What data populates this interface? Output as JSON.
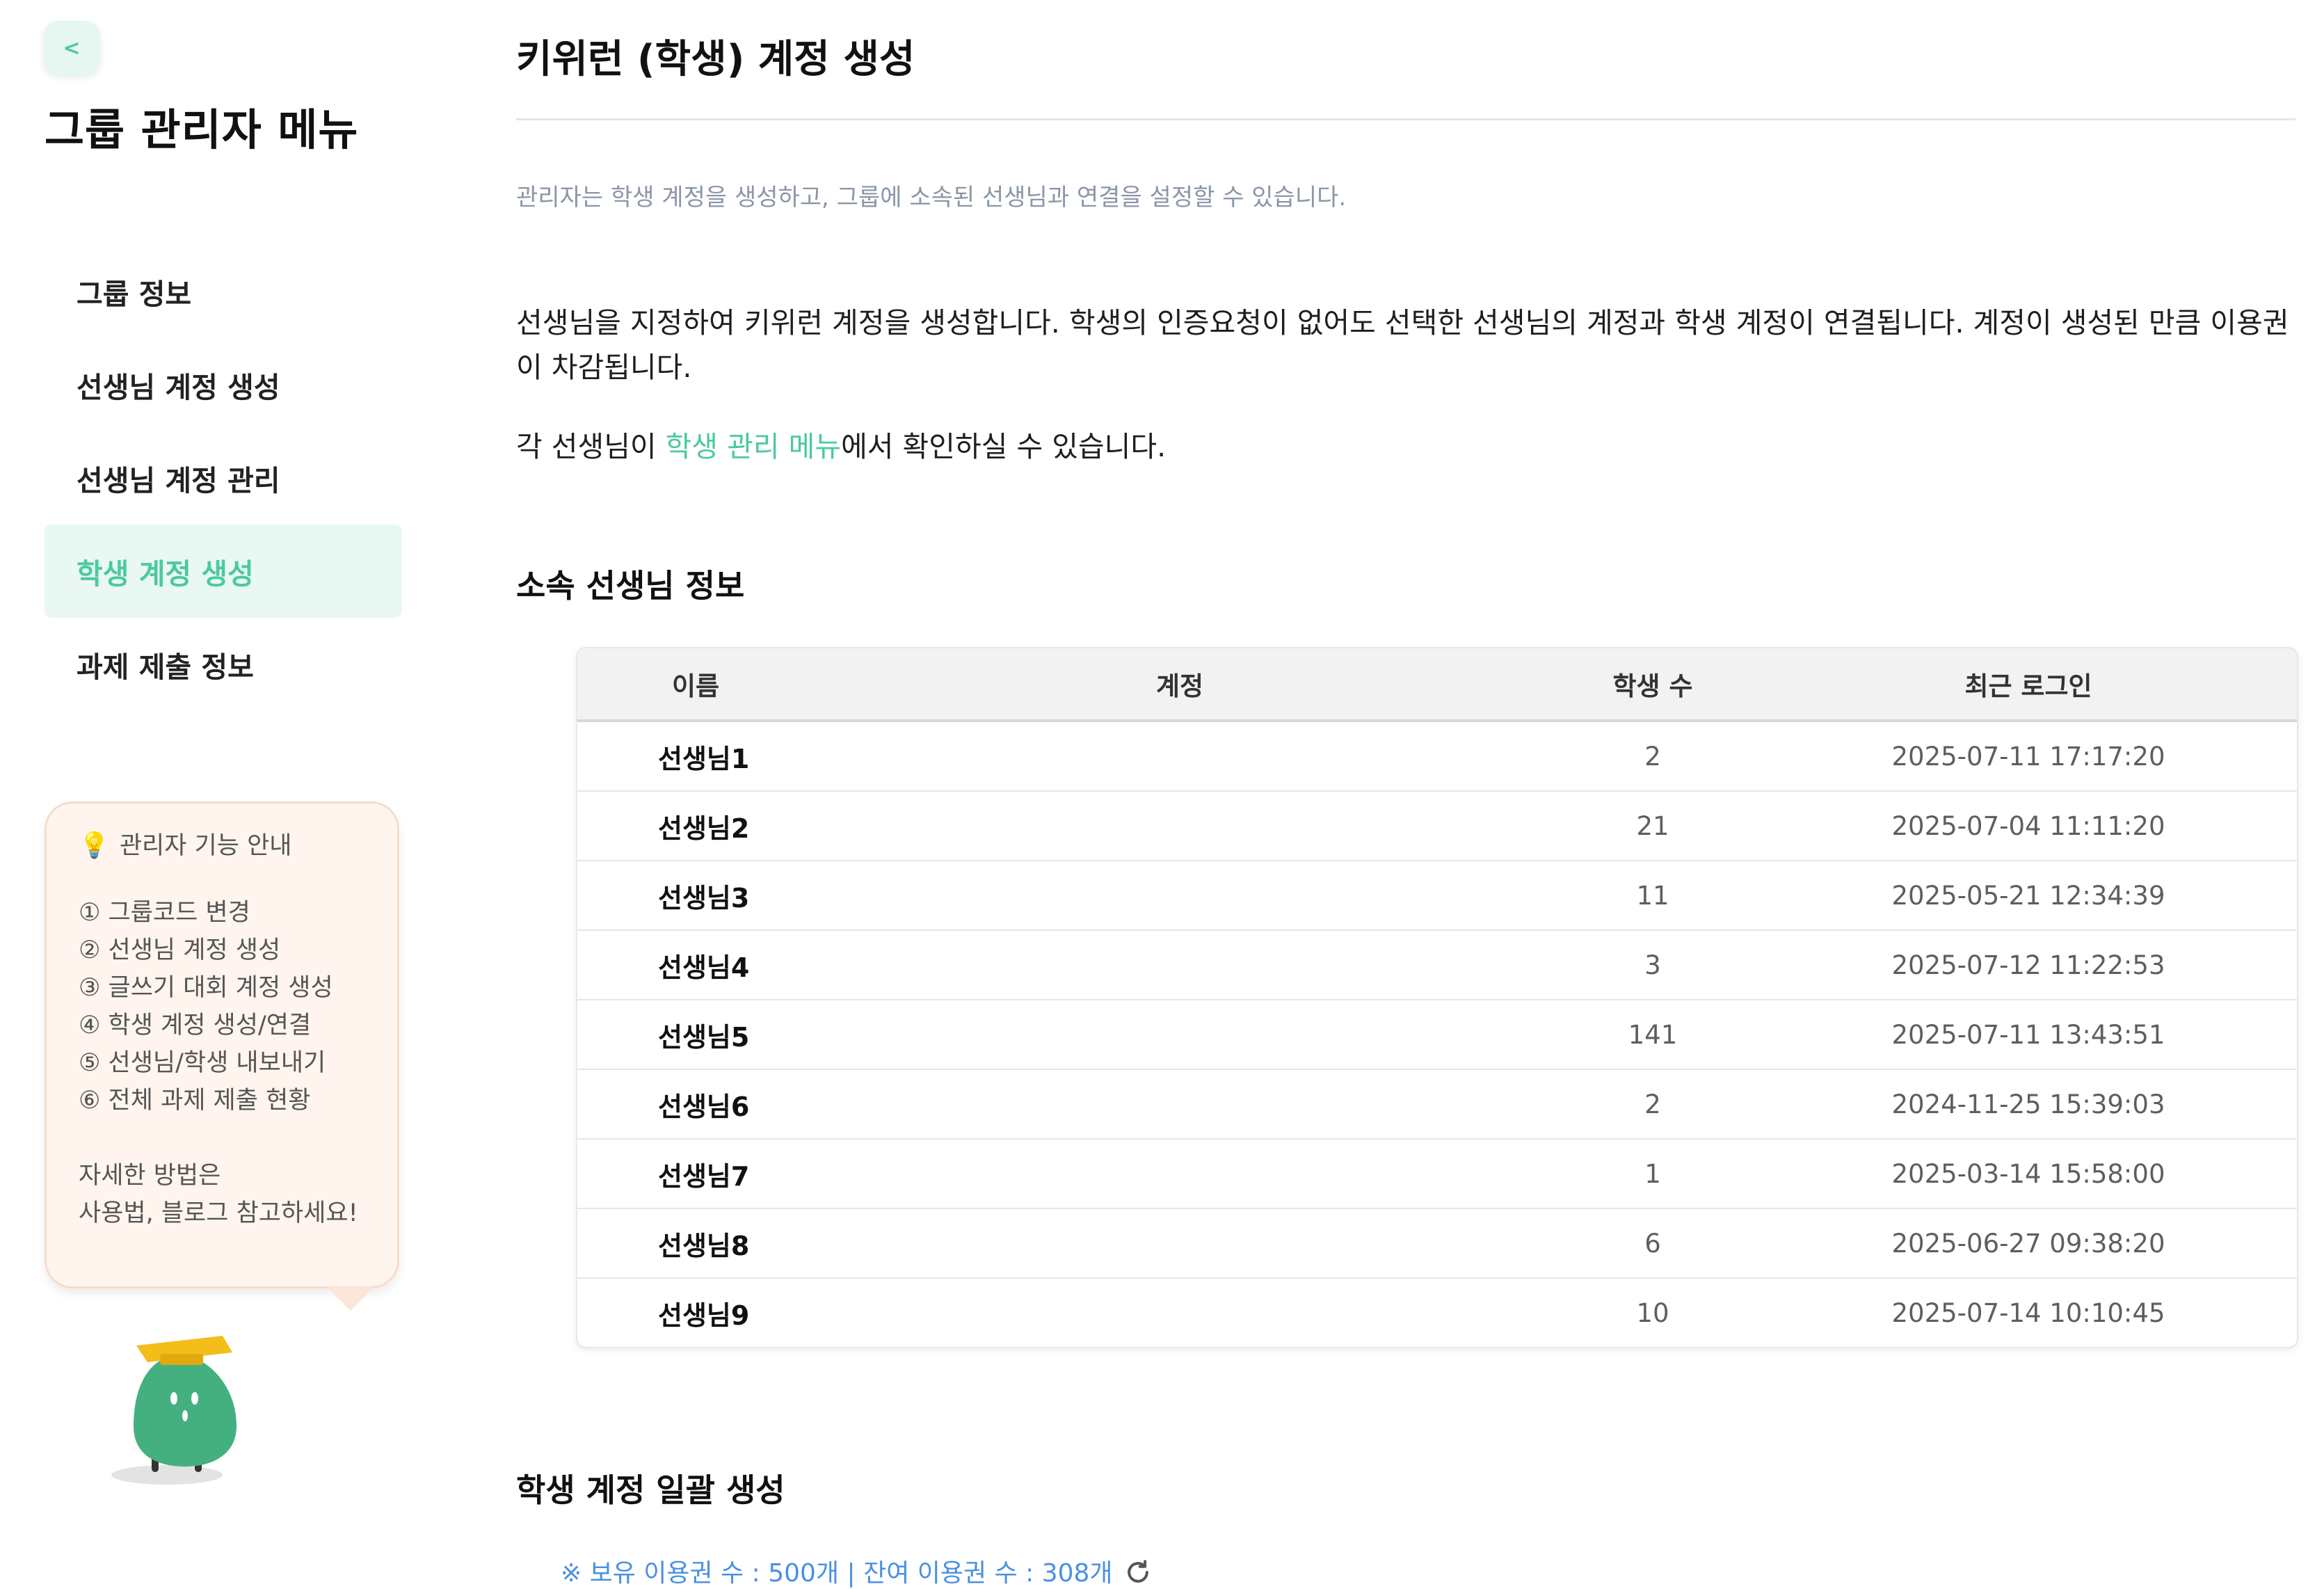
{
  "sidebar": {
    "back_label": "<",
    "title": "그룹 관리자 메뉴",
    "items": [
      {
        "label": "그룹 정보",
        "active": false
      },
      {
        "label": "선생님 계정 생성",
        "active": false
      },
      {
        "label": "선생님 계정 관리",
        "active": false
      },
      {
        "label": "학생 계정 생성",
        "active": true
      },
      {
        "label": "과제 제출 정보",
        "active": false
      }
    ],
    "guide": {
      "icon": "lightbulb-icon",
      "title": "관리자 기능 안내",
      "lines": [
        "① 그룹코드 변경",
        "② 선생님 계정 생성",
        "③ 글쓰기 대회 계정 생성",
        "④ 학생 계정 생성/연결",
        "⑤ 선생님/학생 내보내기",
        "⑥ 전체 과제 제출 현황"
      ],
      "footer": [
        "자세한 방법은",
        "사용법, 블로그 참고하세요!"
      ]
    }
  },
  "main": {
    "title": "키위런 (학생) 계정 생성",
    "subtitle": "관리자는 학생 계정을 생성하고, 그룹에 소속된 선생님과 연결을 설정할 수 있습니다.",
    "description": "선생님을 지정하여 키위런 계정을 생성합니다. 학생의 인증요청이 없어도 선택한 선생님의 계정과 학생 계정이 연결됩니다. 계정이 생성된 만큼 이용권이 차감됩니다.",
    "note_prefix": "각 선생님이 ",
    "note_link": "학생 관리 메뉴",
    "note_suffix": "에서 확인하실 수 있습니다.",
    "teacher_section_title": "소속 선생님 정보",
    "table": {
      "headers": [
        "이름",
        "계정",
        "학생 수",
        "최근 로그인"
      ],
      "rows": [
        {
          "name": "선생님1",
          "account": "",
          "students": "2",
          "last_login": "2025-07-11 17:17:20"
        },
        {
          "name": "선생님2",
          "account": "",
          "students": "21",
          "last_login": "2025-07-04 11:11:20"
        },
        {
          "name": "선생님3",
          "account": "",
          "students": "11",
          "last_login": "2025-05-21 12:34:39"
        },
        {
          "name": "선생님4",
          "account": "",
          "students": "3",
          "last_login": "2025-07-12 11:22:53"
        },
        {
          "name": "선생님5",
          "account": "",
          "students": "141",
          "last_login": "2025-07-11 13:43:51"
        },
        {
          "name": "선생님6",
          "account": "",
          "students": "2",
          "last_login": "2024-11-25 15:39:03"
        },
        {
          "name": "선생님7",
          "account": "",
          "students": "1",
          "last_login": "2025-03-14 15:58:00"
        },
        {
          "name": "선생님8",
          "account": "",
          "students": "6",
          "last_login": "2025-06-27 09:38:20"
        },
        {
          "name": "선생님9",
          "account": "",
          "students": "10",
          "last_login": "2025-07-14 10:10:45"
        }
      ]
    },
    "bulk_section_title": "학생 계정 일괄 생성",
    "quota_text": "※ 보유 이용권 수 : 500개 | 잔여 이용권 수 : 308개",
    "refresh_icon": "refresh-icon"
  },
  "colors": {
    "accent": "#4cc9a0",
    "active_bg": "#eaf8f3",
    "link_blue": "#4a90e2",
    "guide_bg": "#fff5ee"
  }
}
